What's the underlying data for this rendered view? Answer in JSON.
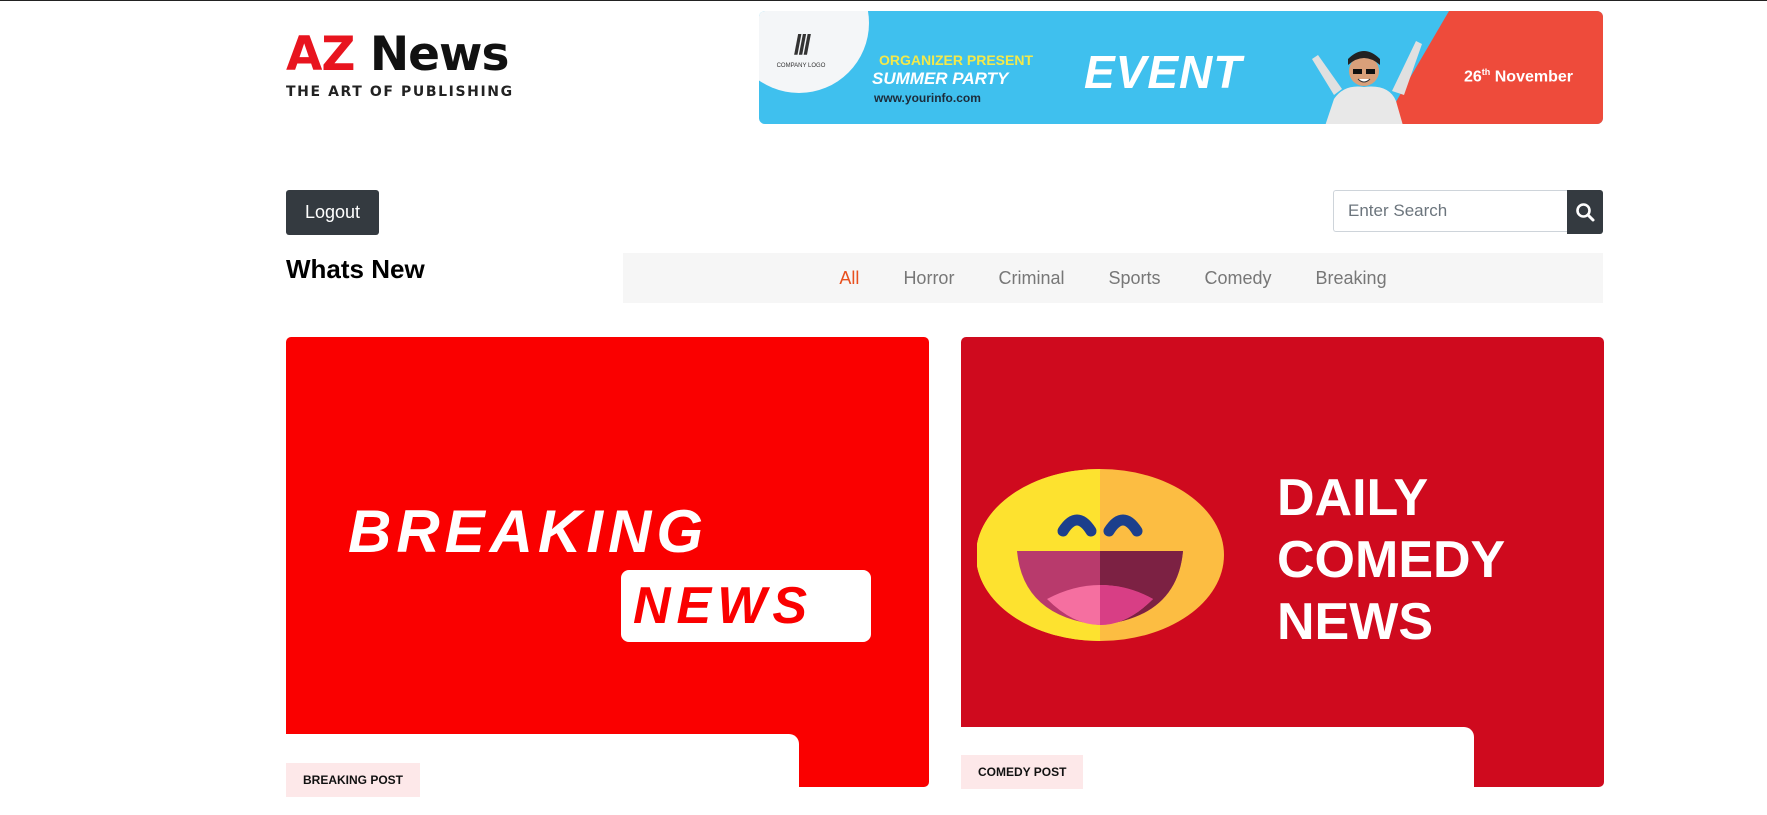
{
  "logo": {
    "brand_a": "AZ",
    "brand_b": "News",
    "tagline": "THE ART OF PUBLISHING"
  },
  "banner": {
    "company_logo_text": "COMPANY LOGO",
    "line1": "ORGANIZER PRESENT",
    "line2": "SUMMER PARTY",
    "line3": "www.yourinfo.com",
    "headline": "EVENT",
    "date_day": "26",
    "date_suffix": "th",
    "date_month": "November",
    "colors": {
      "sky": "#3fc0ee",
      "accent": "#ee4b3b"
    }
  },
  "controls": {
    "logout_label": "Logout",
    "search_placeholder": "Enter Search",
    "search_icon": "search-icon"
  },
  "section": {
    "title": "Whats New"
  },
  "filter_tabs": [
    {
      "label": "All",
      "active": true
    },
    {
      "label": "Horror",
      "active": false
    },
    {
      "label": "Criminal",
      "active": false
    },
    {
      "label": "Sports",
      "active": false
    },
    {
      "label": "Comedy",
      "active": false
    },
    {
      "label": "Breaking",
      "active": false
    }
  ],
  "posts": [
    {
      "category_badge": "BREAKING POST",
      "image_line1": "BREAKING",
      "image_line2": "NEWS",
      "image_color": "#fa0000"
    },
    {
      "category_badge": "COMEDY POST",
      "image_line1": "DAILY",
      "image_line2": "COMEDY",
      "image_line3": "NEWS",
      "image_color": "#cf0a1e"
    }
  ],
  "colors": {
    "brand_red": "#e8141e",
    "active_tab": "#e8501e",
    "dark_button": "#343a40",
    "badge_bg": "#fde8e9"
  }
}
